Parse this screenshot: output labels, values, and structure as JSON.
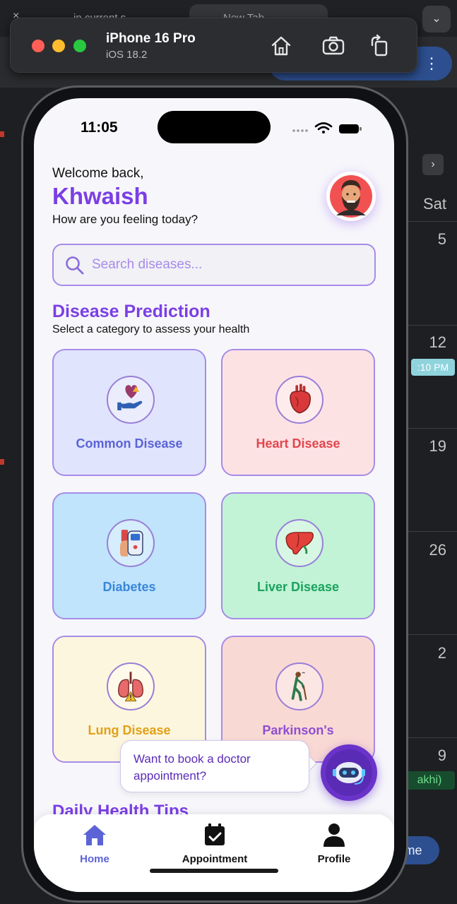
{
  "browser": {
    "tab1_label": "in current s",
    "tab2_label": "New Tab",
    "close_glyph": "×"
  },
  "calendar": {
    "day_header": "Sat",
    "dates": [
      "5",
      "12",
      "19",
      "26",
      "2",
      "9"
    ],
    "event_time": ":10 PM",
    "event_label": "akhi)",
    "pill_label": "me"
  },
  "simulator": {
    "device_name": "iPhone 16 Pro",
    "os_version": "iOS 18.2",
    "icons": [
      "home-icon",
      "screenshot-icon",
      "rotate-icon"
    ]
  },
  "status_bar": {
    "time": "11:05"
  },
  "header": {
    "welcome": "Welcome back,",
    "user_name": "Khwaish",
    "feeling_prompt": "How are you feeling today?"
  },
  "search": {
    "placeholder": "Search diseases..."
  },
  "disease_section": {
    "title": "Disease Prediction",
    "subtitle": "Select a category to assess your health",
    "cards": [
      {
        "label": "Common Disease",
        "icon": "hand-heart-icon",
        "bg": "#e0e4fc",
        "text_color": "#5b63d6"
      },
      {
        "label": "Heart Disease",
        "icon": "heart-organ-icon",
        "bg": "#fde2e4",
        "text_color": "#e0474c"
      },
      {
        "label": "Diabetes",
        "icon": "glucose-meter-icon",
        "bg": "#bfe4fb",
        "text_color": "#3a86d8"
      },
      {
        "label": "Liver Disease",
        "icon": "liver-icon",
        "bg": "#c2f3d6",
        "text_color": "#1aa25e"
      },
      {
        "label": "Lung Disease",
        "icon": "lungs-icon",
        "bg": "#fdf6de",
        "text_color": "#e2a017"
      },
      {
        "label": "Parkinson's",
        "icon": "walking-cane-icon",
        "bg": "#f9d9d4",
        "text_color": "#8e4fd0"
      }
    ]
  },
  "tips_section": {
    "title": "Daily Health Tips"
  },
  "chat_prompt": {
    "text_line1": "Want to book a doctor",
    "text_line2": "appointment?"
  },
  "tabbar": {
    "tabs": [
      {
        "label": "Home",
        "icon": "home-icon",
        "color": "#5b63d6"
      },
      {
        "label": "Appointment",
        "icon": "calendar-check-icon",
        "color": "#111111"
      },
      {
        "label": "Profile",
        "icon": "person-icon",
        "color": "#111111"
      }
    ]
  },
  "colors": {
    "accent": "#7b3fe4",
    "card_border": "#a78be8",
    "bot_button": "#6a33c9"
  }
}
